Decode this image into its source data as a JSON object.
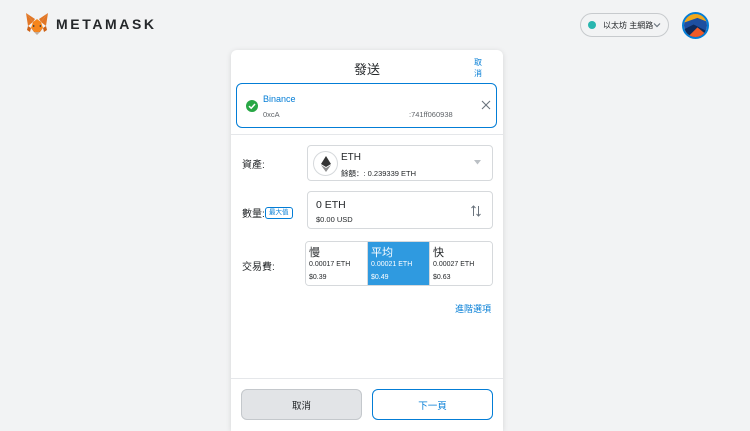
{
  "header": {
    "logo_text": "METAMASK",
    "network": {
      "label": "以太坊 主網路",
      "dot_color": "#29b6af"
    }
  },
  "send": {
    "title": "發送",
    "cancel_label": "取消",
    "recipient": {
      "name": "Binance",
      "address_start": "0xcA",
      "address_end": ":741ff060938"
    },
    "asset": {
      "label": "資產:",
      "symbol": "ETH",
      "balance": "餘額：: 0.239339 ETH"
    },
    "amount": {
      "label": "數量:",
      "max_label": "最大值",
      "value": "0 ETH",
      "usd": "$0.00 USD"
    },
    "fee": {
      "label": "交易費:",
      "options": [
        {
          "name": "慢",
          "eth": "0.00017 ETH",
          "usd": "$0.39",
          "selected": false
        },
        {
          "name": "平均",
          "eth": "0.00021 ETH",
          "usd": "$0.49",
          "selected": true
        },
        {
          "name": "快",
          "eth": "0.00027 ETH",
          "usd": "$0.63",
          "selected": false
        }
      ]
    },
    "advanced_label": "進階選項"
  },
  "footer": {
    "cancel_label": "取消",
    "next_label": "下一頁"
  },
  "colors": {
    "accent": "#037dd6",
    "selected_fee": "#2f9ae0",
    "success": "#28a745"
  },
  "icons": [
    "metamask-fox-icon",
    "chevron-down-icon",
    "account-avatar-icon",
    "check-circle-icon",
    "close-icon",
    "ethereum-icon",
    "caret-down-icon",
    "swap-icon"
  ]
}
